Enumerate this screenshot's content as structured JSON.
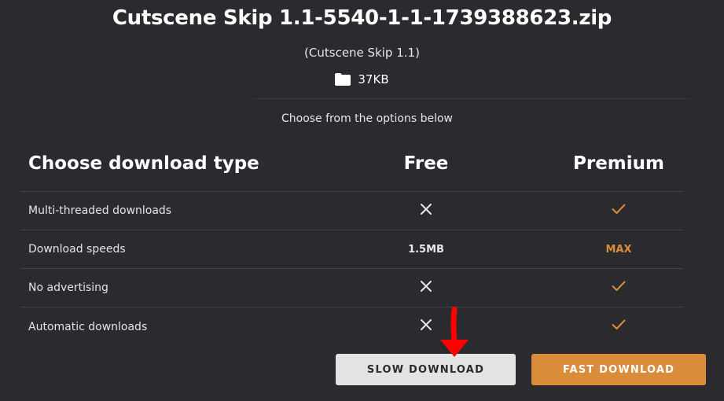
{
  "file": {
    "name": "Cutscene Skip 1.1-5540-1-1-1739388623.zip",
    "mod_label": "(Cutscene Skip 1.1)",
    "size": "37KB"
  },
  "options_prompt": "Choose from the options below",
  "table": {
    "headers": {
      "type": "Choose download type",
      "free": "Free",
      "premium": "Premium"
    },
    "rows": [
      {
        "label": "Multi-threaded downloads",
        "free": "cross-icon",
        "premium": "check-icon"
      },
      {
        "label": "Download speeds",
        "free": "1.5MB",
        "premium": "MAX"
      },
      {
        "label": "No advertising",
        "free": "cross-icon",
        "premium": "check-icon"
      },
      {
        "label": "Automatic downloads",
        "free": "cross-icon",
        "premium": "check-icon"
      }
    ]
  },
  "buttons": {
    "slow": "SLOW DOWNLOAD",
    "fast": "FAST DOWNLOAD"
  },
  "colors": {
    "background": "#2b2a2e",
    "accent": "#d98c3a",
    "slow_button": "#e3e3e3",
    "annotation_arrow": "#ff0000"
  }
}
